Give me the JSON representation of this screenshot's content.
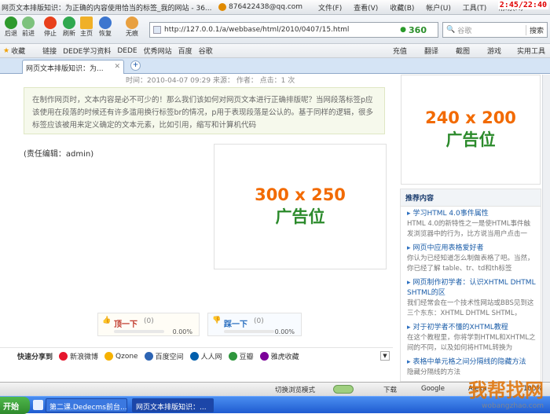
{
  "window": {
    "title": "网页文本排版知识：为正确的内容使用恰当的标签_我的网站 - 36...",
    "account": "876422438@qq.com",
    "menus": [
      "文件(F)",
      "查看(V)",
      "收藏(B)",
      "帐户(U)",
      "工具(T)",
      "帮助(H)"
    ],
    "clock": "2:45/22:40"
  },
  "toolbar": {
    "back": "后退",
    "forward": "前进",
    "stop": "停止",
    "refresh": "刷新",
    "home": "主页",
    "restore": "恢复",
    "traceless": "无痕",
    "url": "http://127.0.0.1/a/webbase/html/2010/0407/15.html",
    "brand": "360",
    "search_placeholder": "谷歌",
    "search_button": "搜索"
  },
  "favorites": {
    "label": "收藏",
    "items": [
      "链接",
      "DEDE学习资料",
      "DEDE",
      "优秀网站",
      "百度",
      "谷歌"
    ],
    "right": [
      "充值",
      "翻译",
      "截图",
      "游戏",
      "实用工具"
    ]
  },
  "tab": {
    "label": "网页文本排版知识：为..."
  },
  "article": {
    "meta": "时间：2010-04-07 09:29  来源：  作者：  点击：1 次",
    "intro": "在制作网页时，文本内容是必不可少的！那么我们该如何对网页文本进行正确排版呢？当网段落标签p应该使用在段落的时候还有许多滥用换行标签br的情况，p用于表现段落是公认的。基于同样的逻辑，很多标签应该被用来定义确定的文本元素，比如引用，缩写和计算机代码",
    "editor": "(责任编辑：admin)"
  },
  "ads": {
    "main": {
      "size": "300 x 250",
      "word": "广告位"
    },
    "side": {
      "size": "240 x 200",
      "word": "广告位"
    }
  },
  "recommend": {
    "title": "推荐内容",
    "items": [
      {
        "title": "学习HTML 4.0事件属性",
        "desc": "HTML 4.0的新特性之一是使HTML事件触发浏览器中的行为，比方说当用户点击一"
      },
      {
        "title": "网页中应用表格爱好者",
        "desc": "你认为已经知道怎么制做表格了吧。当然，你已经了解 table、tr、td和th标签"
      },
      {
        "title": "网页制作初学者：认识XHTML DHTML SHTML的区",
        "desc": "我们经常会在一个技术性网站或BBS见到这三个东东：XHTML DHTML SHTML，"
      },
      {
        "title": "对于初学者不懂的XHTML教程",
        "desc": "在这个教程里，你将学到HTML和XHTML之间的不同，以及如何将HTML转换为"
      },
      {
        "title": "表格中单元格之间分隔线的隐藏方法",
        "desc": "隐藏分隔线的方法"
      }
    ]
  },
  "vote": {
    "up": {
      "label": "顶一下",
      "count": "(0)",
      "percent": "0.00%",
      "fill": 0
    },
    "down": {
      "label": "踩一下",
      "count": "(0)",
      "percent": "0.00%",
      "fill": 0
    }
  },
  "share": {
    "label": "快速分享到",
    "targets": [
      {
        "name": "新浪微博",
        "color": "#e6162d"
      },
      {
        "name": "Qzone",
        "color": "#f6b100"
      },
      {
        "name": "百度空间",
        "color": "#2d64b3"
      },
      {
        "name": "人人网",
        "color": "#005eac"
      },
      {
        "name": "豆瓣",
        "color": "#2e963d"
      },
      {
        "name": "雅虎收藏",
        "color": "#7b0099"
      }
    ]
  },
  "status": {
    "switch_mode": "切换浏览模式",
    "download": "下载",
    "google": "Google",
    "alexa": "Alexa",
    "zoom": "100%"
  },
  "taskbar": {
    "start": "开始",
    "tasks": [
      "第二课.Dedecms前台...",
      "网页文本排版知识：..."
    ]
  },
  "watermark": {
    "text": "我帮找网",
    "sub": "wobangzhao.com"
  }
}
